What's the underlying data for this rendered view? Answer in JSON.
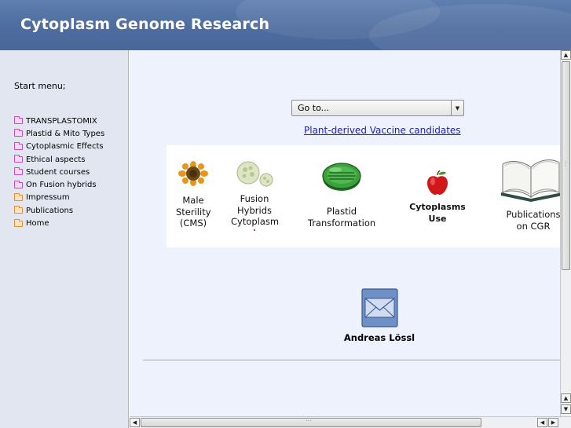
{
  "header": {
    "title": "Cytoplasm Genome Research"
  },
  "sidebar": {
    "start_label": "Start menu;",
    "items": [
      {
        "label": "TRANSPLASTOMIX",
        "icon": "folder-pink-icon"
      },
      {
        "label": "Plastid & Mito Types",
        "icon": "folder-pink-icon"
      },
      {
        "label": "Cytoplasmic Effects",
        "icon": "folder-pink-icon"
      },
      {
        "label": "Ethical aspects",
        "icon": "folder-pink-icon"
      },
      {
        "label": "Student courses",
        "icon": "folder-pink-icon"
      },
      {
        "label": "On Fusion hybrids",
        "icon": "folder-pink-icon"
      },
      {
        "label": "Impressum",
        "icon": "folder-orange-icon"
      },
      {
        "label": "Publications",
        "icon": "folder-orange-icon"
      },
      {
        "label": "Home",
        "icon": "folder-orange-icon"
      }
    ]
  },
  "main": {
    "goto": {
      "selected": "Go to..."
    },
    "vaccine_link": "Plant-derived Vaccine candidates",
    "tiles": [
      {
        "lines": [
          "Male",
          "Sterility",
          "(CMS)"
        ],
        "icon": "sunflower-icon"
      },
      {
        "lines": [
          "Fusion",
          "Hybrids",
          "Cytoplasm"
        ],
        "icon": "protoplast-cells-icon"
      },
      {
        "lines": [
          "Plastid",
          "Transformation"
        ],
        "icon": "petri-dish-icon"
      },
      {
        "lines": [
          "Cytoplasms",
          "Use"
        ],
        "icon": "apple-icon"
      },
      {
        "lines": [
          "Publications",
          "on CGR"
        ],
        "icon": "open-book-icon"
      }
    ],
    "contact": {
      "name": "Andreas Lössl",
      "icon": "mail-envelope-icon"
    }
  },
  "colors": {
    "header_bg": "#5070a3",
    "sidebar_bg": "#e1e6f0",
    "main_bg": "#eef2fc",
    "link": "#1a1ad0"
  }
}
